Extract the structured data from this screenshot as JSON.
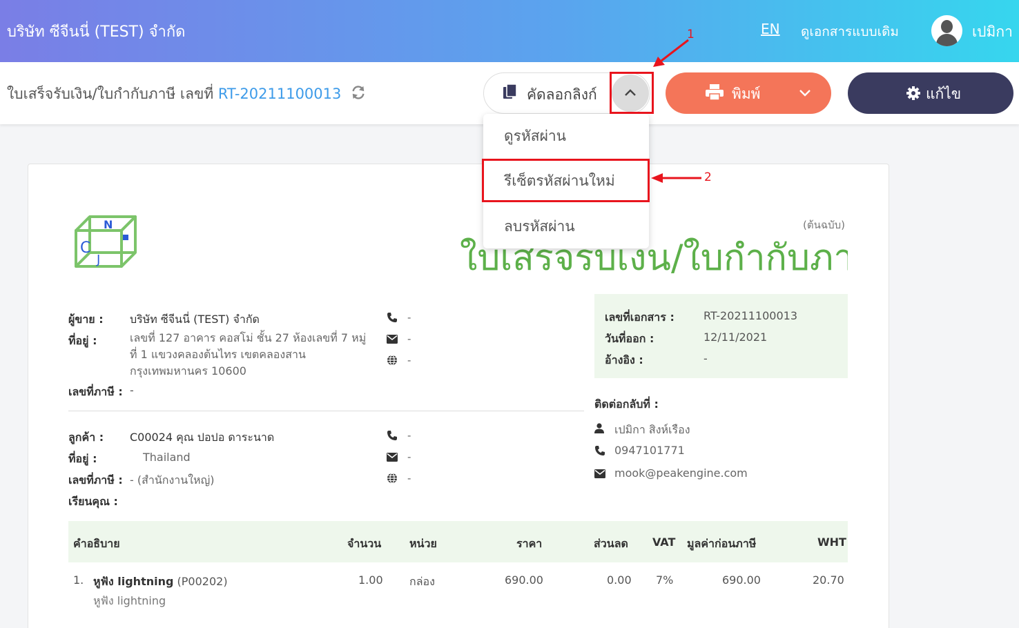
{
  "header": {
    "company": "บริษัท ซีจีนนี่ (TEST) จำกัด",
    "lang": "EN",
    "old_doc": "ดูเอกสารแบบเดิม",
    "user": "เปมิกา"
  },
  "toolbar": {
    "title_prefix": "ใบเสร็จรับเงิน/ใบกำกับภาษี เลขที่",
    "doc_number": "RT-20211100013",
    "copy_link": "คัดลอกลิงก์",
    "print": "พิมพ์",
    "edit": "แก้ไข"
  },
  "menu": {
    "items": [
      "ดูรหัสผ่าน",
      "รีเซ็ตรหัสผ่านใหม่",
      "ลบรหัสผ่าน"
    ]
  },
  "annotations": {
    "one": "1",
    "two": "2"
  },
  "document": {
    "copy_tag": "(ต้นฉบับ)",
    "title": "ใบเสร็จรับเงิน/ใบกำกับภาษี",
    "seller_label": "ผู้ขาย :",
    "seller": "บริษัท ซีจีนนี่ (TEST) จำกัด",
    "address_label": "ที่อยู่ :",
    "seller_address": "เลขที่ 127 อาคาร คอสโม่ ชั้น 27 ห้องเลขที่ 7 หมู่ที่ 1 แขวงคลองต้นไทร เขตคลองสาน กรุงเทพมหานคร 10600",
    "tax_label": "เลขที่ภาษี :",
    "seller_tax": "-",
    "dash": "-",
    "customer_label": "ลูกค้า :",
    "customer": "C00024 คุณ ปอปอ ดาระนาด",
    "customer_address": "Thailand",
    "customer_tax": "- (สำนักงานใหญ่)",
    "attn_label": "เรียนคุณ :",
    "info": {
      "doc_no_label": "เลขที่เอกสาร :",
      "doc_no": "RT-20211100013",
      "date_label": "วันที่ออก :",
      "date": "12/11/2021",
      "ref_label": "อ้างอิง :",
      "ref": "-"
    },
    "contact_label": "ติดต่อกลับที่ :",
    "contact_name": "เปมิกา สิงห์เรือง",
    "contact_phone": "0947101771",
    "contact_email": "mook@peakengine.com"
  },
  "table": {
    "headers": {
      "desc": "คำอธิบาย",
      "qty": "จำนวน",
      "unit": "หน่วย",
      "price": "ราคา",
      "discount": "ส่วนลด",
      "vat": "VAT",
      "pretax": "มูลค่าก่อนภาษี",
      "wht": "WHT"
    },
    "row": {
      "index": "1.",
      "name": "หูฟัง lightning",
      "code": "(P00202)",
      "sub": "หูฟัง lightning",
      "qty": "1.00",
      "unit": "กล่อง",
      "price": "690.00",
      "discount": "0.00",
      "vat": "7%",
      "pretax": "690.00",
      "wht": "20.70"
    }
  }
}
